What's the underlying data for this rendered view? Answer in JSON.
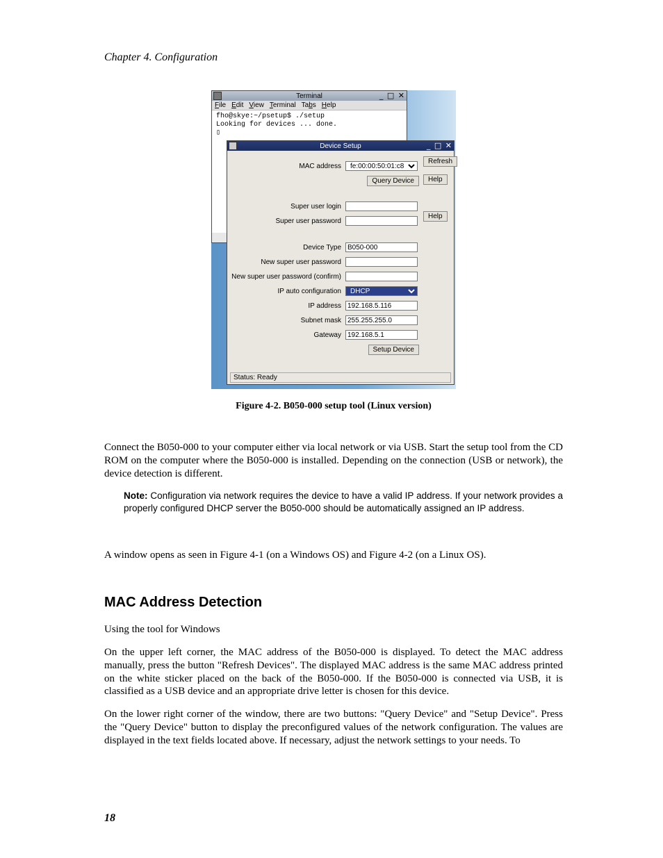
{
  "header": {
    "chapter_line": "Chapter 4. Configuration"
  },
  "figure": {
    "terminal": {
      "title": "Terminal",
      "window_controls": "_ □ ✕",
      "menus": {
        "file": "File",
        "edit": "Edit",
        "view": "View",
        "terminal": "Terminal",
        "tabs": "Tabs",
        "help": "Help"
      },
      "line1": "fho@skye:~/psetup$ ./setup",
      "line2": "Looking for devices ... done.",
      "cursor": "▯"
    },
    "device_setup": {
      "title": "Device Setup",
      "window_controls": "_ □ ✕",
      "mac_address_label": "MAC address",
      "mac_address_value": "fe:00:00:50:01:c8",
      "query_device_btn": "Query Device",
      "refresh_btn": "Refresh",
      "help_btn": "Help",
      "super_user_login_label": "Super user login",
      "super_user_login_value": "",
      "super_user_password_label": "Super user password",
      "super_user_password_value": "",
      "device_type_label": "Device Type",
      "device_type_value": "B050-000",
      "new_su_pw_label": "New super user password",
      "new_su_pw_value": "",
      "new_su_pw_confirm_label": "New super user password (confirm)",
      "new_su_pw_confirm_value": "",
      "ip_auto_label": "IP auto configuration",
      "ip_auto_value": "DHCP",
      "ip_address_label": "IP address",
      "ip_address_value": "192.168.5.116",
      "subnet_label": "Subnet mask",
      "subnet_value": "255.255.255.0",
      "gateway_label": "Gateway",
      "gateway_value": "192.168.5.1",
      "setup_device_btn": "Setup Device",
      "status": "Status: Ready"
    },
    "caption": "Figure 4-2. B050-000 setup tool (Linux version)"
  },
  "body": {
    "para1": "Connect the B050-000 to your computer either via local network or via USB. Start the setup tool from the CD ROM on the computer where the B050-000 is installed. Depending on the connection (USB or network), the device detection is different.",
    "note_label": "Note:",
    "note_text": " Configuration via network requires the device to have a valid IP address. If your network provides a properly configured DHCP server the B050-000 should be automatically assigned an IP address.",
    "para2": "A window opens as seen in Figure 4-1 (on a Windows OS) and Figure 4-2 (on a Linux OS).",
    "section_heading": "MAC Address Detection",
    "para3": "Using the tool for Windows",
    "para4": "On the upper left corner, the MAC address of the B050-000 is displayed. To detect the MAC address manually, press the button \"Refresh Devices\". The displayed MAC address is the same MAC address printed on the white sticker placed on the back of the B050-000. If the B050-000 is connected via USB, it is classified as a USB device and an appropriate drive letter is chosen for this device.",
    "para5": "On the lower right corner of the window, there are two buttons: \"Query Device\" and \"Setup Device\". Press the \"Query Device\" button to display the preconfigured values of the network configuration. The values are displayed in the text fields located above. If necessary, adjust the network settings to your needs. To"
  },
  "page_number": "18"
}
